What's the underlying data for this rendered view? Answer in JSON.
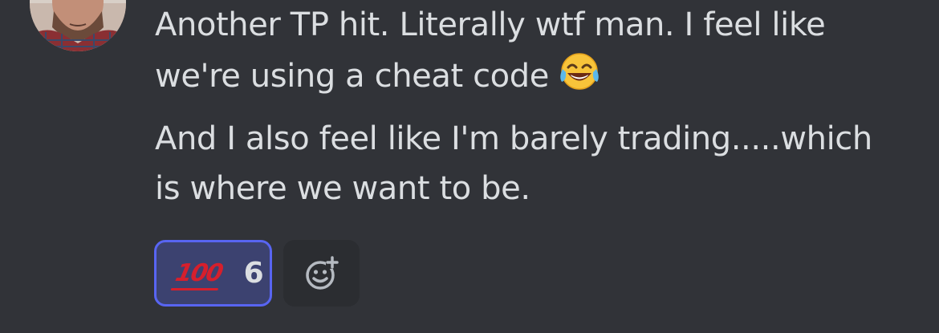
{
  "message": {
    "paragraphs": [
      {
        "lines": [
          "Another TP hit. Literally wtf man. I feel like",
          "we're using a cheat code"
        ],
        "emoji": "face-with-tears-of-joy-emoji"
      },
      {
        "lines": [
          "And I also feel like I'm barely trading.....which",
          "is where we want to be."
        ]
      }
    ]
  },
  "reactions": [
    {
      "emoji": "hundred-points-emoji",
      "emoji_text": "100",
      "count": "6",
      "active": true
    }
  ],
  "add_reaction_icon": "add-reaction-icon",
  "colors": {
    "background": "#313338",
    "text": "#dbdee1",
    "reaction_border": "#5865f2",
    "reaction_bg": "#3c4270",
    "hundred_red": "#d61f2c"
  }
}
